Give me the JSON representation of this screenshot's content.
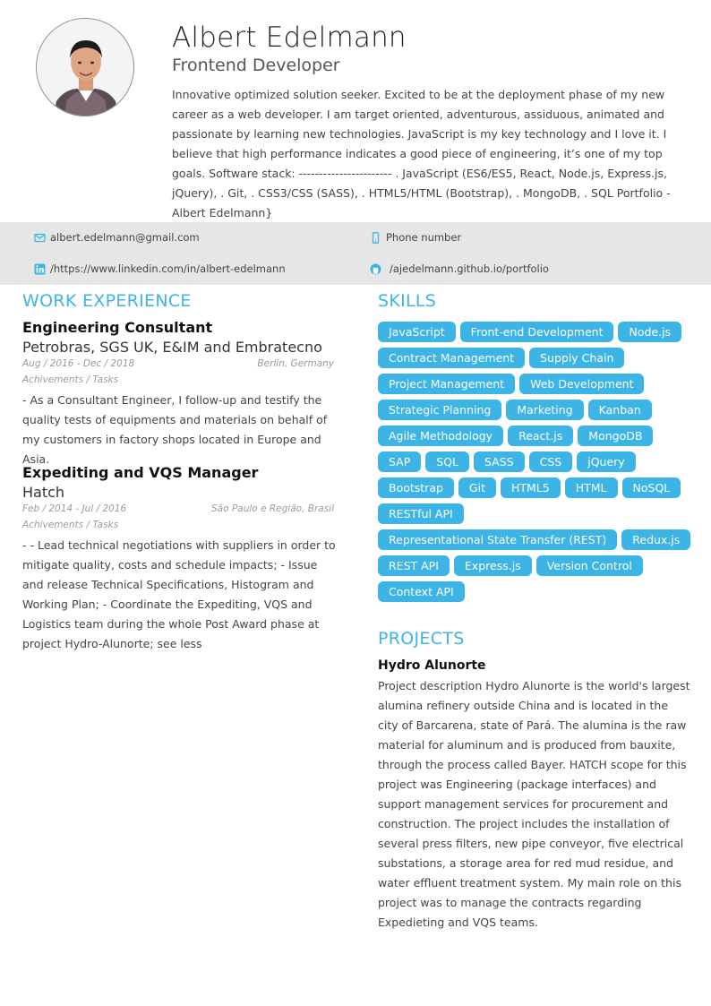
{
  "header": {
    "name": "Albert Edelmann",
    "role": "Frontend Developer",
    "summary": "Innovative optimized solution seeker. Excited to be at the deployment phase of my new career as a web developer. I am target oriented, adventurous, assiduous, animated and passionate by learning new technologies. JavaScript is my key technology and I love it. I believe that high performance indicates a good piece of engineering, it’s one of my top goals. Software stack: ----------------------- . JavaScript (ES6/ES5, React, Node.js, Express.js, jQuery), . Git, . CSS3/CSS (SASS), . HTML5/HTML (Bootstrap), . MongoDB, . SQL Portfolio - Albert Edelmann}"
  },
  "contact": {
    "email": "albert.edelmann@gmail.com",
    "phone": "Phone number",
    "linkedin": "/https://www.linkedin.com/in/albert-edelmann",
    "github": "/ajedelmann.github.io/portfolio",
    "icons": [
      "envelope-icon",
      "mobile-phone-icon",
      "linkedin-icon",
      "github-icon"
    ]
  },
  "work": {
    "title": "WORK EXPERIENCE",
    "jobs": [
      {
        "title": "Engineering Consultant",
        "company": "Petrobras, SGS UK, E&IM and Embratecno",
        "dates": "Aug  /  2016  -  Dec  /  2018",
        "location": "Berlin, Germany",
        "sub": "Achivements / Tasks",
        "description": "- As a Consultant Engineer, I follow-up and testify the quality tests of equipments and materials on behalf of my customers in factory shops located in Europe and Asia."
      },
      {
        "title": "Expediting and VQS Manager",
        "company": "Hatch",
        "dates": "Feb  /  2014  -  Jul  /  2016",
        "location": "São Paulo e Região, Brasil",
        "sub": "Achivements / Tasks",
        "description": "- - Lead technical negotiations with suppliers in order to mitigate quality, costs and schedule impacts; - Issue and release Technical Specifications, Histogram and Working Plan; - Coordinate the Expediting, VQS and Logistics team during the whole Post Award phase at project Hydro-Alunorte; see less"
      }
    ]
  },
  "skills": {
    "title": "SKILLS",
    "items": [
      "JavaScript",
      "Front-end Development",
      "Node.js",
      "Contract Management",
      "Supply Chain",
      "Project Management",
      "Web Development",
      "Strategic Planning",
      "Marketing",
      "Kanban",
      "Agile Methodology",
      "React.js",
      "MongoDB",
      "SAP",
      "SQL",
      "SASS",
      "CSS",
      "jQuery",
      "Bootstrap",
      "Git",
      "HTML5",
      "HTML",
      "NoSQL",
      "RESTful API",
      "Representational State Transfer (REST)",
      "Redux.js",
      "REST API",
      "Express.js",
      "Version Control",
      "Context API"
    ]
  },
  "projects": {
    "title": "PROJECTS",
    "items": [
      {
        "title": "Hydro Alunorte",
        "description": "Project description Hydro Alunorte is the world's largest alumina refinery outside China and is located in the city of Barcarena, state of Pará. The alumina is the raw material for aluminum and is produced from bauxite, through the process called Bayer. HATCH scope for this project was Engineering (package interfaces) and support management services for procurement and construction. The project includes the installation of several press filters, new pipe conveyor, five electrical substations, a storage area for red mud residue, and water effluent treatment system. My main role on this project was to manage the contracts regarding Expedieting and VQS teams."
      }
    ]
  },
  "colors": {
    "accent": "#3db4e6",
    "band": "#e6e6e6",
    "text": "#444444"
  }
}
